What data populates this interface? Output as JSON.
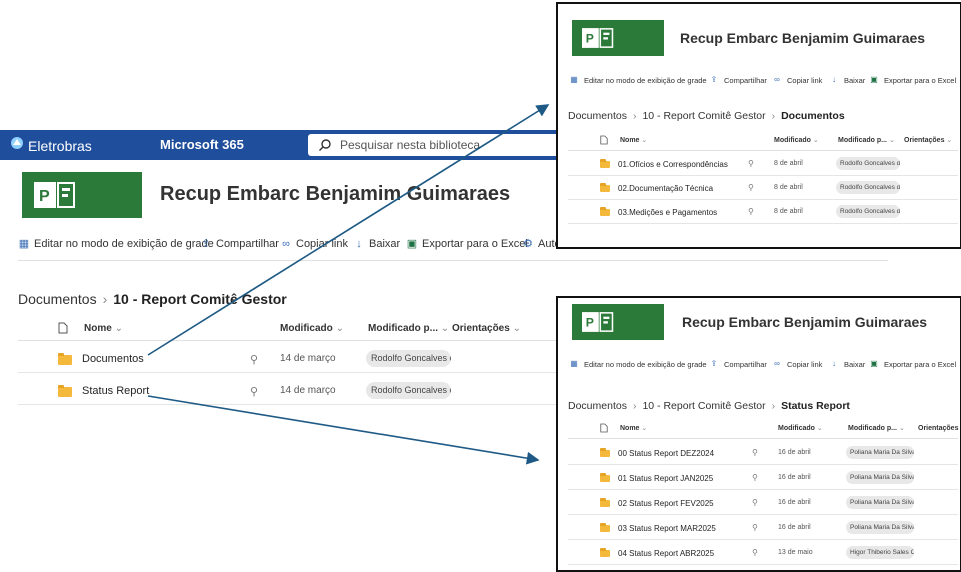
{
  "colors": {
    "suitebar": "#1f4e9c",
    "project_green": "#2c7a3a",
    "arrow": "#1e5a85",
    "folder": "#f4b83b"
  },
  "main": {
    "brand": "Eletrobras",
    "suite": "Microsoft 365",
    "search_placeholder": "Pesquisar nesta biblioteca",
    "site_title": "Recup Embarc Benjamim Guimaraes",
    "commands": [
      "Editar no modo de exibição de grade",
      "Compartilhar",
      "Copiar link",
      "Baixar",
      "Exportar para o Excel",
      "Auto"
    ],
    "breadcrumb": {
      "root": "Documentos",
      "current": "10 - Report Comitê Gestor"
    },
    "columns": {
      "name": "Nome",
      "modified": "Modificado",
      "modified_by": "Modificado p...",
      "orientation": "Orientações"
    },
    "rows": [
      {
        "name": "Documentos",
        "date": "14 de março",
        "by": "Rodolfo Goncalves dc"
      },
      {
        "name": "Status Report",
        "date": "14 de março",
        "by": "Rodolfo Goncalves dc"
      }
    ]
  },
  "inset_top": {
    "site_title": "Recup Embarc Benjamim Guimaraes",
    "commands": [
      "Editar no modo de exibição de grade",
      "Compartilhar",
      "Copiar link",
      "Baixar",
      "Exportar para o Excel"
    ],
    "breadcrumb": {
      "root": "Documentos",
      "middle": "10 - Report Comitê Gestor",
      "current": "Documentos"
    },
    "columns": {
      "name": "Nome",
      "modified": "Modificado",
      "modified_by": "Modificado p...",
      "orientation": "Orientações"
    },
    "rows": [
      {
        "name": "01.Ofícios e Correspondências",
        "date": "8 de abril",
        "by": "Rodolfo Goncalves dc"
      },
      {
        "name": "02.Documentação Técnica",
        "date": "8 de abril",
        "by": "Rodolfo Goncalves dc"
      },
      {
        "name": "03.Medições e Pagamentos",
        "date": "8 de abril",
        "by": "Rodolfo Goncalves dc"
      }
    ]
  },
  "inset_bottom": {
    "site_title": "Recup Embarc Benjamim Guimaraes",
    "commands": [
      "Editar no modo de exibição de grade",
      "Compartilhar",
      "Copiar link",
      "Baixar",
      "Exportar para o Excel"
    ],
    "breadcrumb": {
      "root": "Documentos",
      "middle": "10 - Report Comitê Gestor",
      "current": "Status Report"
    },
    "columns": {
      "name": "Nome",
      "modified": "Modificado",
      "modified_by": "Modificado p...",
      "orientation": "Orientações"
    },
    "rows": [
      {
        "name": "00 Status Report DEZ2024",
        "date": "16 de abril",
        "by": "Poliana Maria Da Silva"
      },
      {
        "name": "01 Status Report JAN2025",
        "date": "16 de abril",
        "by": "Poliana Maria Da Silva"
      },
      {
        "name": "02 Status Report FEV2025",
        "date": "16 de abril",
        "by": "Poliana Maria Da Silva"
      },
      {
        "name": "03 Status Report MAR2025",
        "date": "16 de abril",
        "by": "Poliana Maria Da Silva"
      },
      {
        "name": "04 Status Report ABR2025",
        "date": "13 de maio",
        "by": "Higor Thiberio Sales C"
      }
    ]
  }
}
